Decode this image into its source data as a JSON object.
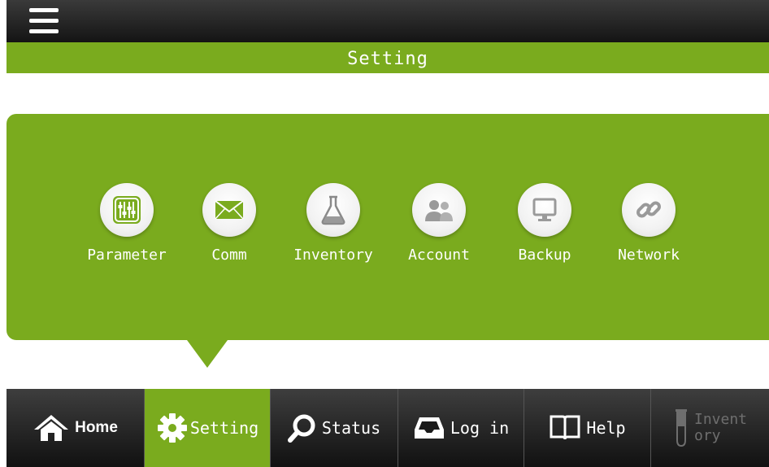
{
  "header": {
    "title": "Setting"
  },
  "settings": [
    {
      "label": "Parameter",
      "icon": "sliders-icon"
    },
    {
      "label": "Comm",
      "icon": "envelope-icon"
    },
    {
      "label": "Inventory",
      "icon": "flask-icon"
    },
    {
      "label": "Account",
      "icon": "users-icon"
    },
    {
      "label": "Backup",
      "icon": "monitor-icon"
    },
    {
      "label": "Network",
      "icon": "link-icon"
    }
  ],
  "tabs": [
    {
      "label": "Home",
      "icon": "home-icon"
    },
    {
      "label": "Setting",
      "icon": "gear-icon",
      "active": true
    },
    {
      "label": "Status",
      "icon": "search-icon"
    },
    {
      "label": "Log in",
      "icon": "tray-icon"
    },
    {
      "label": "Help",
      "icon": "book-icon"
    },
    {
      "label_line1": "Invent",
      "label_line2": "ory",
      "icon": "test-tube-icon",
      "disabled": true
    }
  ],
  "colors": {
    "accent": "#7aab1e",
    "bar": "#1a1a1a",
    "icon": "#9a9a9a"
  }
}
